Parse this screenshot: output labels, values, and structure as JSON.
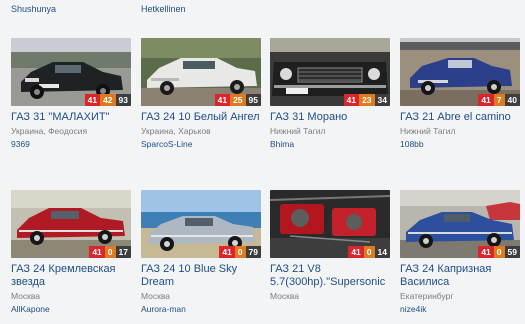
{
  "top_users": [
    "Shushunya",
    "Hetkellinen"
  ],
  "cards": [
    {
      "title": "ГАЗ 31 \"МАЛАХИТ\"",
      "city": "Украина, Феодосия",
      "user": "9369",
      "counts": [
        "41",
        "42",
        "93"
      ],
      "scene": "black-sedan-plate"
    },
    {
      "title": "ГАЗ 24 10 Белый Ангел",
      "city": "Украина, Харьков",
      "user": "SparcoS-Line",
      "counts": [
        "41",
        "25",
        "95"
      ],
      "scene": "white-sedan"
    },
    {
      "title": "ГАЗ 31 Морано",
      "city": "Нижний Тагил",
      "user": "Bhima",
      "counts": [
        "41",
        "23",
        "34"
      ],
      "scene": "black-sedan-front"
    },
    {
      "title": "ГАЗ 21 Abre el camino",
      "city": "Нижний Тагил",
      "user": "108bb",
      "counts": [
        "41",
        "7",
        "40"
      ],
      "scene": "blue-volga-garage"
    },
    {
      "title": "ГАЗ 24 Кремлевская звезда",
      "city": "Москва",
      "user": "AllKapone",
      "counts": [
        "41",
        "0",
        "17"
      ],
      "scene": "red-sedan"
    },
    {
      "title": "ГАЗ 24 10 Blue Sky Dream",
      "city": "Москва",
      "user": "Aurora-man",
      "counts": [
        "41",
        "0",
        "79"
      ],
      "scene": "silver-sedan-sea"
    },
    {
      "title": "ГАЗ 21 V8 5.7(300hp).\"Supersonic",
      "city": "Москва",
      "user": "",
      "counts": [
        "41",
        "0",
        "14"
      ],
      "scene": "engine-bay"
    },
    {
      "title": "ГАЗ 24 Капризная Василиса",
      "city": "Екатеринбург",
      "user": "nize4ik",
      "counts": [
        "41",
        "0",
        "59"
      ],
      "scene": "blue-sedan-lot"
    }
  ]
}
